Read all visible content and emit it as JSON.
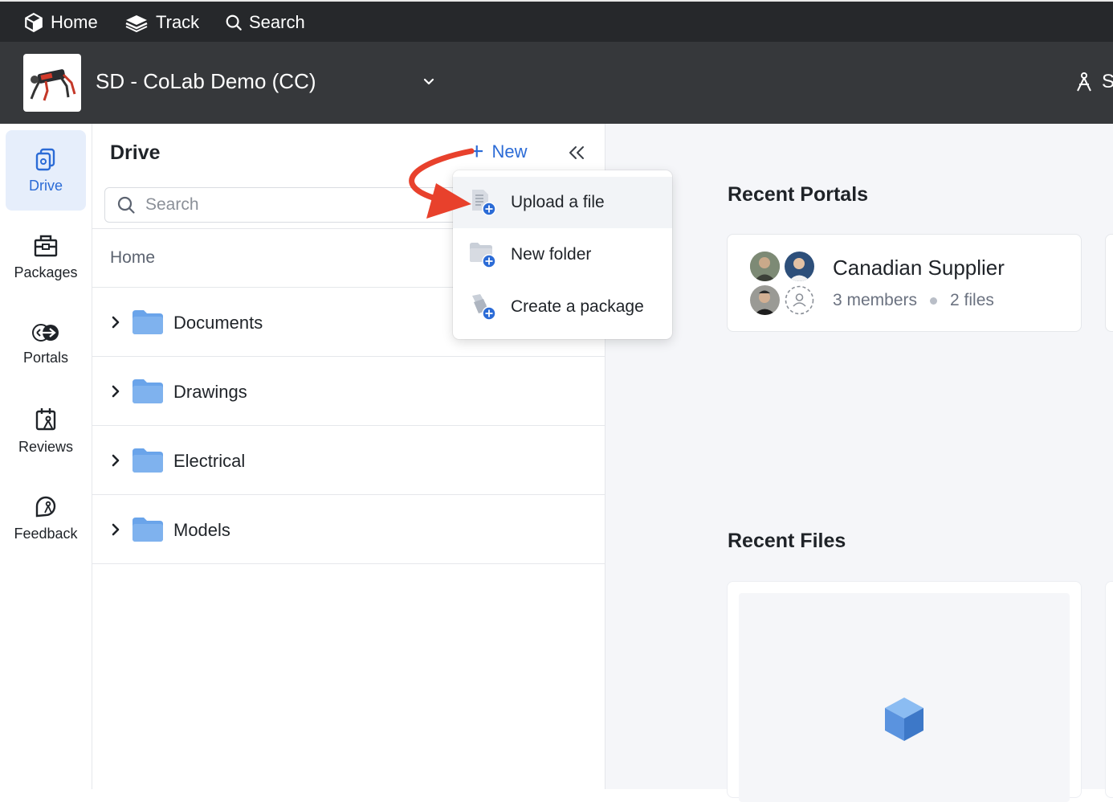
{
  "topnav": {
    "home_label": "Home",
    "track_label": "Track",
    "search_label": "Search"
  },
  "workspace": {
    "title": "SD - CoLab Demo (CC)",
    "right_label": "S"
  },
  "rail": {
    "items": [
      {
        "label": "Drive",
        "icon": "drive-icon",
        "active": true
      },
      {
        "label": "Packages",
        "icon": "package-icon"
      },
      {
        "label": "Portals",
        "icon": "portal-icon"
      },
      {
        "label": "Reviews",
        "icon": "review-icon"
      },
      {
        "label": "Feedback",
        "icon": "feedback-icon"
      }
    ]
  },
  "drive": {
    "title": "Drive",
    "new_label": "New",
    "search_placeholder": "Search",
    "breadcrumb": "Home",
    "folders": [
      {
        "name": "Documents"
      },
      {
        "name": "Drawings"
      },
      {
        "name": "Electrical"
      },
      {
        "name": "Models"
      }
    ]
  },
  "new_menu": {
    "items": [
      {
        "label": "Upload a file",
        "icon": "upload-file-icon"
      },
      {
        "label": "New folder",
        "icon": "new-folder-icon"
      },
      {
        "label": "Create a package",
        "icon": "create-package-icon"
      }
    ]
  },
  "main": {
    "recent_portals_title": "Recent Portals",
    "recent_files_title": "Recent Files",
    "portal": {
      "name": "Canadian Supplier",
      "members": "3 members",
      "files": "2 files"
    }
  },
  "colors": {
    "accent": "#2b6bd6",
    "topbar": "#26282b",
    "workspace_bar": "#36383b",
    "annotation_arrow": "#e8412c",
    "folder": "#6aa4ea"
  }
}
